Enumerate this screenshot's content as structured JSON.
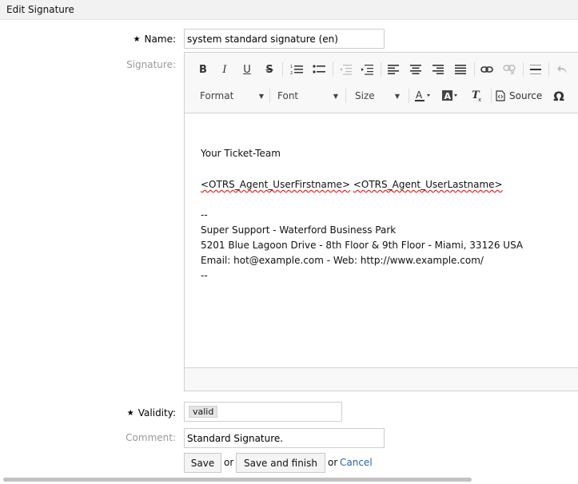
{
  "header": {
    "title": "Edit Signature"
  },
  "form": {
    "name": {
      "label": "Name:",
      "required_mark": "★",
      "value": "system standard signature (en)"
    },
    "signature": {
      "label": "Signature:"
    },
    "validity": {
      "label": "Validity:",
      "required_mark": "★",
      "value": "valid"
    },
    "comment": {
      "label": "Comment:",
      "value": "Standard Signature."
    }
  },
  "editor": {
    "toolbar": {
      "bold": "B",
      "italic": "I",
      "underline": "U",
      "strike": "S",
      "format_label": "Format",
      "font_label": "Font",
      "size_label": "Size",
      "source_label": "Source",
      "special_char": "Ω",
      "icons": [
        "bold-icon",
        "italic-icon",
        "underline-icon",
        "strikethrough-icon",
        "numbered-list-icon",
        "bulleted-list-icon",
        "outdent-icon",
        "indent-icon",
        "align-left-icon",
        "align-center-icon",
        "align-right-icon",
        "justify-icon",
        "link-icon",
        "unlink-icon",
        "horizontal-line-icon",
        "undo-icon",
        "text-color-icon",
        "background-color-icon",
        "remove-format-icon",
        "source-icon",
        "special-character-icon"
      ]
    },
    "content": {
      "greeting": "Your Ticket-Team",
      "agent_line_first": "<OTRS_Agent_UserFirstname>",
      "agent_line_last": "<OTRS_Agent_UserLastname>",
      "sep1": "--",
      "company": "Super Support - Waterford Business Park",
      "address": "5201 Blue Lagoon Drive - 8th Floor & 9th Floor - Miami, 33126 USA",
      "contact": "Email: hot@example.com - Web: http://www.example.com/",
      "sep2": "--"
    }
  },
  "actions": {
    "save": "Save",
    "or1": "or",
    "save_finish": "Save and finish",
    "or2": "or",
    "cancel": "Cancel"
  }
}
